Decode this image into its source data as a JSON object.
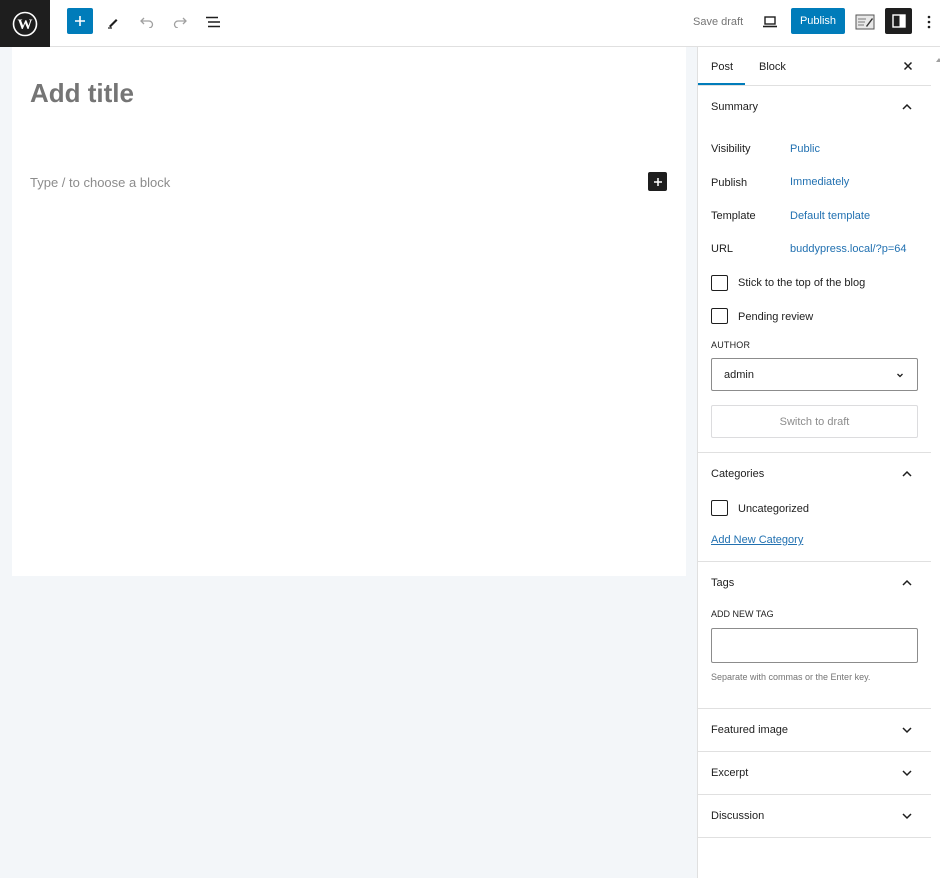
{
  "toolbar": {
    "logo_icon": "wordpress-logo",
    "add_icon": "plus-icon",
    "tools_icon": "pencil-icon",
    "undo_icon": "undo-icon",
    "redo_icon": "redo-icon",
    "list_view_icon": "list-view-icon",
    "save_draft_label": "Save draft",
    "preview_icon": "laptop-icon",
    "publish_label": "Publish",
    "external_icon": "edit-image-icon",
    "settings_icon": "sidebar-toggle-icon",
    "more_icon": "more-vertical-icon",
    "accent_color": "#007cba"
  },
  "editor": {
    "title_placeholder": "Add title",
    "block_placeholder": "Type / to choose a block"
  },
  "sidebar": {
    "tabs": [
      {
        "label": "Post",
        "active": true
      },
      {
        "label": "Block",
        "active": false
      }
    ],
    "summary": {
      "title": "Summary",
      "expanded": true,
      "rows": [
        {
          "label": "Visibility",
          "value": "Public"
        },
        {
          "label": "Publish",
          "value": "Immediately"
        },
        {
          "label": "Template",
          "value": "Default template"
        },
        {
          "label": "URL",
          "value": "buddypress.local/?p=64"
        }
      ],
      "checkboxes": [
        {
          "label": "Stick to the top of the blog",
          "checked": false
        },
        {
          "label": "Pending review",
          "checked": false
        }
      ],
      "author_label": "AUTHOR",
      "author_value": "admin",
      "switch_draft_label": "Switch to draft"
    },
    "categories": {
      "title": "Categories",
      "expanded": true,
      "items": [
        {
          "label": "Uncategorized",
          "checked": false
        }
      ],
      "add_new_label": "Add New Category"
    },
    "tags": {
      "title": "Tags",
      "expanded": true,
      "add_new_label": "ADD NEW TAG",
      "input_value": "",
      "help": "Separate with commas or the Enter key."
    },
    "collapsed_panels": [
      {
        "title": "Featured image"
      },
      {
        "title": "Excerpt"
      },
      {
        "title": "Discussion"
      }
    ]
  }
}
